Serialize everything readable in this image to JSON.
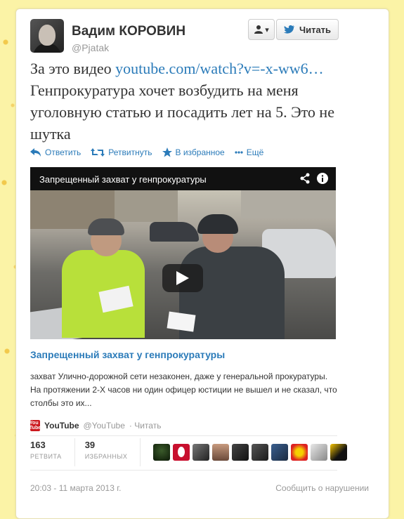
{
  "user": {
    "name": "Вадим КОРОВИН",
    "handle": "@Pjatak"
  },
  "follow_button": {
    "label": "Читать"
  },
  "tweet": {
    "text_before": "За это видео ",
    "link": "youtube.com/watch?v=-x-ww6…",
    "text_after": " Генпрокуратура хочет возбудить на меня уголовную статью и посадить лет на 5. Это не шутка"
  },
  "actions": [
    {
      "label": "Ответить",
      "icon": "reply-icon"
    },
    {
      "label": "Ретвитнуть",
      "icon": "retweet-icon"
    },
    {
      "label": "В избранное",
      "icon": "star-icon"
    },
    {
      "label": "Ещё",
      "icon": "more-icon"
    }
  ],
  "video": {
    "player_title": "Запрещенный захват у генпрокуратуры",
    "link_title": "Запрещенный захват у генпрокуратуры",
    "description": "захват Улично-дорожной сети незаконен, даже у генеральной прокуратуры. На протяжении 2-Х часов ни один офицер юстиции не вышел и не сказал, что столбы это их...",
    "source_name": "YouTube",
    "source_handle": "@YouTube",
    "source_follow": "· Читать"
  },
  "stats": {
    "retweets": {
      "count": "163",
      "label": "РЕТВИТА"
    },
    "favorites": {
      "count": "39",
      "label": "ИЗБРАННЫХ"
    }
  },
  "footer": {
    "timestamp": "20:03 - 11 марта 2013 г.",
    "report": "Сообщить о нарушении"
  },
  "colors": {
    "link": "#2b7bb9",
    "background": "#fbf3a6"
  }
}
